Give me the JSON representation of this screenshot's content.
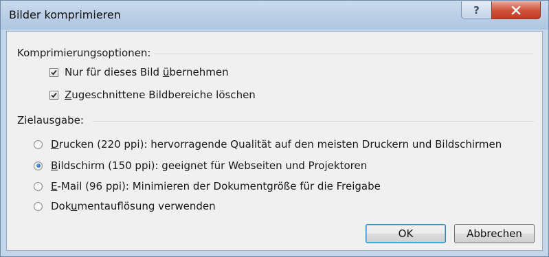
{
  "window": {
    "title": "Bilder komprimieren",
    "help_icon": "help-icon",
    "close_icon": "close-icon"
  },
  "compression": {
    "group_title": "Komprimierungsoptionen:",
    "options": [
      {
        "pre": "Nur für dieses Bild ",
        "ul": "ü",
        "post": "bernehmen",
        "checked": true
      },
      {
        "pre": "",
        "ul": "Z",
        "post": "ugeschnittene Bildbereiche löschen",
        "checked": true
      }
    ]
  },
  "target": {
    "group_title": "Zielausgabe:",
    "options": [
      {
        "pre": "",
        "ul": "D",
        "post": "rucken (220 ppi): hervorragende Qualität auf den meisten Druckern und Bildschirmen",
        "selected": false
      },
      {
        "pre": "",
        "ul": "B",
        "post": "ildschirm (150 ppi): geeignet für Webseiten und Projektoren",
        "selected": true
      },
      {
        "pre": "",
        "ul": "E",
        "post": "-Mail (96 ppi): Minimieren der Dokumentgröße für die Freigabe",
        "selected": false
      },
      {
        "pre": "Dok",
        "ul": "u",
        "post": "mentauflösung verwenden",
        "selected": false
      }
    ]
  },
  "buttons": {
    "ok": "OK",
    "cancel": "Abbrechen"
  },
  "colors": {
    "titlebar": "#bcd0e6",
    "close": "#c23a22",
    "dialog_bg": "#f0f0f0"
  }
}
